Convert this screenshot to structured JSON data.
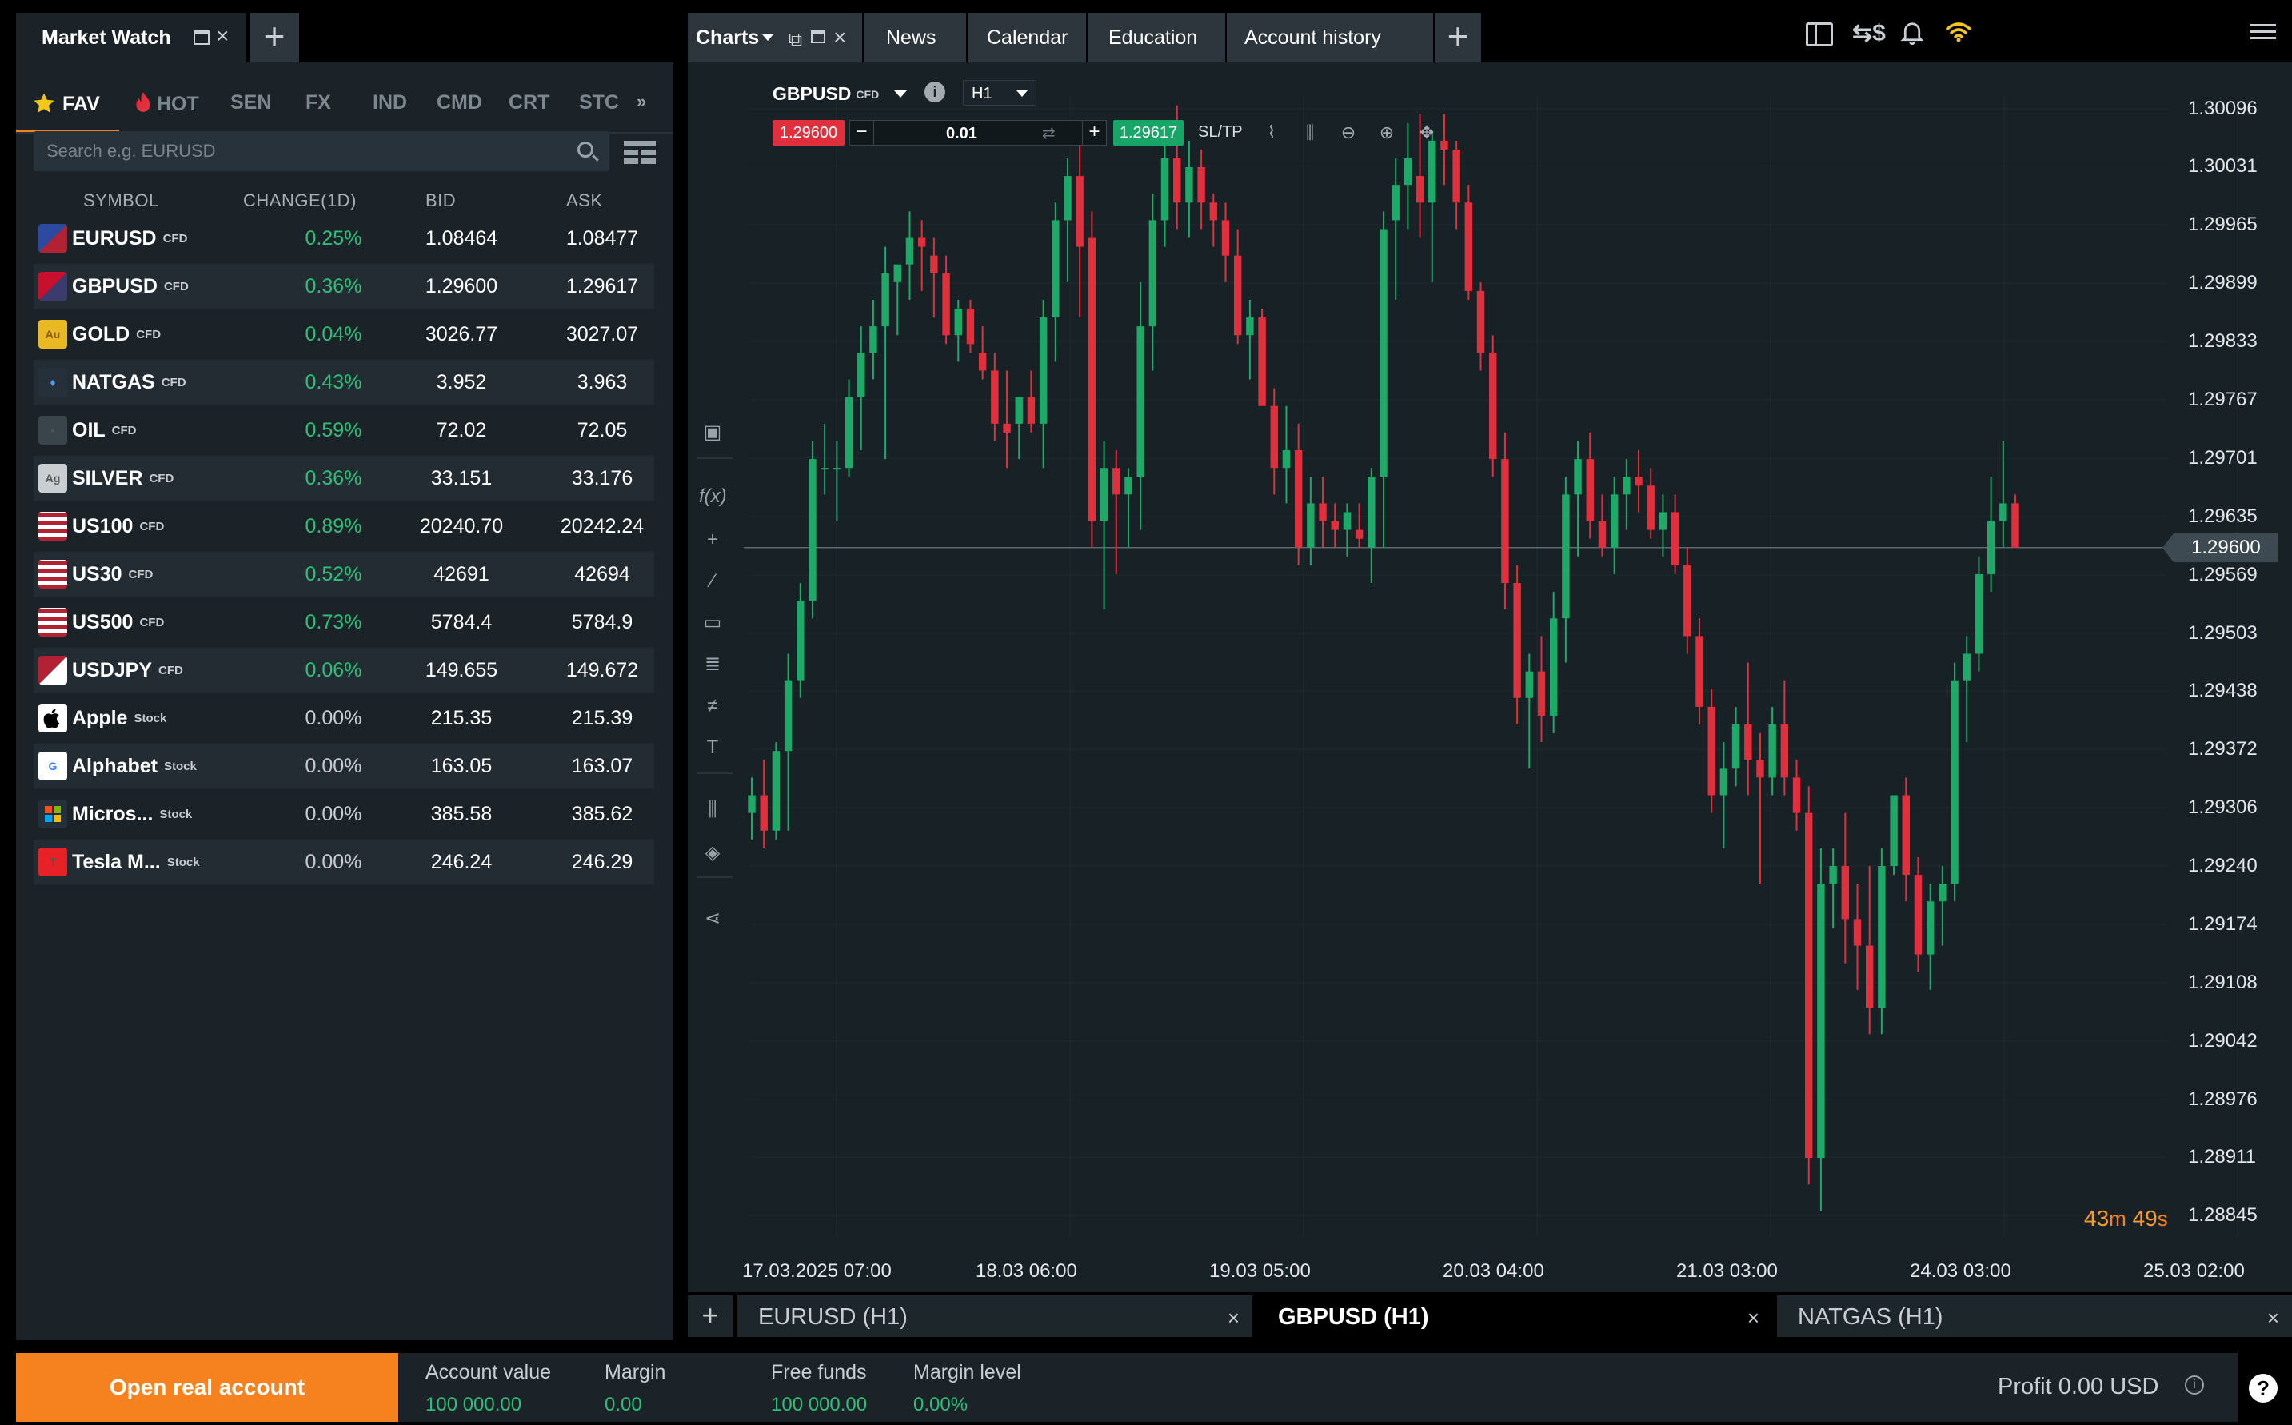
{
  "market_watch": {
    "title": "Market Watch",
    "categories": [
      {
        "label": "FAV",
        "icon": "star-icon",
        "active": true
      },
      {
        "label": "HOT",
        "icon": "flame-icon",
        "active": false
      },
      {
        "label": "SEN",
        "active": false
      },
      {
        "label": "FX",
        "active": false
      },
      {
        "label": "IND",
        "active": false
      },
      {
        "label": "CMD",
        "active": false
      },
      {
        "label": "CRT",
        "active": false
      },
      {
        "label": "STC",
        "active": false
      }
    ],
    "search_placeholder": "Search e.g. EURUSD",
    "columns": {
      "symbol": "SYMBOL",
      "change": "CHANGE(1D)",
      "bid": "BID",
      "ask": "ASK"
    },
    "rows": [
      {
        "symbol": "EURUSD",
        "type": "CFD",
        "change": "0.25%",
        "bid": "1.08464",
        "ask": "1.08477",
        "flag": "eu-us-flag-icon"
      },
      {
        "symbol": "GBPUSD",
        "type": "CFD",
        "change": "0.36%",
        "bid": "1.29600",
        "ask": "1.29617",
        "flag": "gb-us-flag-icon"
      },
      {
        "symbol": "GOLD",
        "type": "CFD",
        "change": "0.04%",
        "bid": "3026.77",
        "ask": "3027.07",
        "flag": "gold-icon"
      },
      {
        "symbol": "NATGAS",
        "type": "CFD",
        "change": "0.43%",
        "bid": "3.952",
        "ask": "3.963",
        "flag": "gas-flame-icon"
      },
      {
        "symbol": "OIL",
        "type": "CFD",
        "change": "0.59%",
        "bid": "72.02",
        "ask": "72.05",
        "flag": "oil-barrel-icon"
      },
      {
        "symbol": "SILVER",
        "type": "CFD",
        "change": "0.36%",
        "bid": "33.151",
        "ask": "33.176",
        "flag": "silver-icon"
      },
      {
        "symbol": "US100",
        "type": "CFD",
        "change": "0.89%",
        "bid": "20240.70",
        "ask": "20242.24",
        "flag": "us-flag-icon"
      },
      {
        "symbol": "US30",
        "type": "CFD",
        "change": "0.52%",
        "bid": "42691",
        "ask": "42694",
        "flag": "us-flag-icon"
      },
      {
        "symbol": "US500",
        "type": "CFD",
        "change": "0.73%",
        "bid": "5784.4",
        "ask": "5784.9",
        "flag": "us-flag-icon"
      },
      {
        "symbol": "USDJPY",
        "type": "CFD",
        "change": "0.06%",
        "bid": "149.655",
        "ask": "149.672",
        "flag": "us-jp-flag-icon"
      },
      {
        "symbol": "Apple",
        "type": "Stock",
        "change": "0.00%",
        "bid": "215.35",
        "ask": "215.39",
        "flag": "apple-logo-icon"
      },
      {
        "symbol": "Alphabet",
        "type": "Stock",
        "change": "0.00%",
        "bid": "163.05",
        "ask": "163.07",
        "flag": "google-logo-icon"
      },
      {
        "symbol": "Micros...",
        "type": "Stock",
        "change": "0.00%",
        "bid": "385.58",
        "ask": "385.62",
        "flag": "microsoft-logo-icon"
      },
      {
        "symbol": "Tesla M...",
        "type": "Stock",
        "change": "0.00%",
        "bid": "246.24",
        "ask": "246.29",
        "flag": "tesla-logo-icon"
      }
    ]
  },
  "top_tabs": {
    "charts": "Charts",
    "news": "News",
    "calendar": "Calendar",
    "education": "Education",
    "account_history": "Account history"
  },
  "chart": {
    "symbol": "GBPUSD",
    "symbol_type": "CFD",
    "timeframe": "H1",
    "sell_price": "1.29600",
    "buy_price": "1.29617",
    "volume": "0.01",
    "sltp_label": "SL/TP",
    "current_price_tag": "1.29600",
    "countdown": {
      "min": "43",
      "min_unit": "m",
      "sec": "49",
      "sec_unit": "s"
    }
  },
  "chart_data": {
    "type": "candlestick",
    "x_tick_labels": [
      "17.03.2025 07:00",
      "18.03 06:00",
      "19.03 05:00",
      "20.03 04:00",
      "21.03 03:00",
      "24.03 03:00",
      "25.03 02:00"
    ],
    "y_tick_labels": [
      "1.30096",
      "1.30031",
      "1.29965",
      "1.29899",
      "1.29833",
      "1.29767",
      "1.29701",
      "1.29635",
      "1.29569",
      "1.29503",
      "1.29438",
      "1.29372",
      "1.29306",
      "1.29240",
      "1.29174",
      "1.29108",
      "1.29042",
      "1.28976",
      "1.28911",
      "1.28845"
    ],
    "ylim": [
      1.28845,
      1.30096
    ],
    "current_price": 1.296,
    "candles": [
      [
        1.293,
        1.2934,
        1.2927,
        1.2932
      ],
      [
        1.2932,
        1.2936,
        1.2926,
        1.2928
      ],
      [
        1.2928,
        1.2938,
        1.2927,
        1.2937
      ],
      [
        1.2937,
        1.2948,
        1.2928,
        1.2945
      ],
      [
        1.2945,
        1.2956,
        1.2943,
        1.2954
      ],
      [
        1.2954,
        1.2972,
        1.2952,
        1.297
      ],
      [
        1.2969,
        1.2974,
        1.2966,
        1.2969
      ],
      [
        1.2969,
        1.2972,
        1.2963,
        1.2969
      ],
      [
        1.2969,
        1.2979,
        1.2968,
        1.2977
      ],
      [
        1.2977,
        1.2985,
        1.2971,
        1.2982
      ],
      [
        1.2982,
        1.2988,
        1.2979,
        1.2985
      ],
      [
        1.2985,
        1.2994,
        1.297,
        1.2991
      ],
      [
        1.299,
        1.2992,
        1.2984,
        1.2992
      ],
      [
        1.2992,
        1.2998,
        1.2988,
        1.2995
      ],
      [
        1.2995,
        1.2997,
        1.2989,
        1.2994
      ],
      [
        1.2993,
        1.2995,
        1.2986,
        1.2991
      ],
      [
        1.2991,
        1.2993,
        1.2983,
        1.2984
      ],
      [
        1.2984,
        1.2988,
        1.2981,
        1.2987
      ],
      [
        1.2987,
        1.2988,
        1.2982,
        1.2983
      ],
      [
        1.2982,
        1.2985,
        1.2979,
        1.298
      ],
      [
        1.298,
        1.2982,
        1.2972,
        1.2974
      ],
      [
        1.2974,
        1.298,
        1.2969,
        1.2973
      ],
      [
        1.2974,
        1.2977,
        1.297,
        1.2977
      ],
      [
        1.2977,
        1.298,
        1.2973,
        1.2974
      ],
      [
        1.2974,
        1.2988,
        1.2969,
        1.2986
      ],
      [
        1.2986,
        1.2999,
        1.2981,
        1.2997
      ],
      [
        1.2997,
        1.3004,
        1.299,
        1.3002
      ],
      [
        1.3002,
        1.3008,
        1.2986,
        1.2994
      ],
      [
        1.2995,
        1.2998,
        1.296,
        1.2963
      ],
      [
        1.2963,
        1.2972,
        1.2953,
        1.2969
      ],
      [
        1.2969,
        1.2971,
        1.2957,
        1.2966
      ],
      [
        1.2966,
        1.2969,
        1.296,
        1.2968
      ],
      [
        1.2968,
        1.299,
        1.2962,
        1.2985
      ],
      [
        1.2985,
        1.3,
        1.298,
        1.2997
      ],
      [
        1.2997,
        1.3008,
        1.2994,
        1.3004
      ],
      [
        1.3004,
        1.301,
        1.2996,
        1.2999
      ],
      [
        1.2999,
        1.3006,
        1.2995,
        1.3003
      ],
      [
        1.3003,
        1.3005,
        1.2996,
        1.2999
      ],
      [
        1.2999,
        1.3,
        1.2994,
        1.2997
      ],
      [
        1.2997,
        1.2999,
        1.299,
        1.2993
      ],
      [
        1.2993,
        1.2996,
        1.2983,
        1.2984
      ],
      [
        1.2984,
        1.2988,
        1.2979,
        1.2986
      ],
      [
        1.2986,
        1.2987,
        1.2977,
        1.2976
      ],
      [
        1.2976,
        1.2978,
        1.2966,
        1.2969
      ],
      [
        1.2969,
        1.2976,
        1.2965,
        1.2971
      ],
      [
        1.2971,
        1.2974,
        1.2958,
        1.296
      ],
      [
        1.296,
        1.2968,
        1.2958,
        1.2965
      ],
      [
        1.2965,
        1.2968,
        1.296,
        1.2963
      ],
      [
        1.2963,
        1.2965,
        1.296,
        1.2962
      ],
      [
        1.2962,
        1.2965,
        1.2959,
        1.2964
      ],
      [
        1.2962,
        1.2965,
        1.296,
        1.2961
      ],
      [
        1.296,
        1.2969,
        1.2956,
        1.2968
      ],
      [
        1.2968,
        1.2998,
        1.296,
        1.2996
      ],
      [
        1.2997,
        1.3004,
        1.2988,
        1.3001
      ],
      [
        1.3001,
        1.3008,
        1.2996,
        1.3004
      ],
      [
        1.3002,
        1.3009,
        1.2995,
        1.2999
      ],
      [
        1.2999,
        1.3007,
        1.299,
        1.3006
      ],
      [
        1.3006,
        1.3009,
        1.3001,
        1.3005
      ],
      [
        1.3005,
        1.3006,
        1.2996,
        1.2999
      ],
      [
        1.2999,
        1.3001,
        1.2988,
        1.2989
      ],
      [
        1.2989,
        1.299,
        1.298,
        1.2982
      ],
      [
        1.2982,
        1.2984,
        1.2968,
        1.297
      ],
      [
        1.297,
        1.2973,
        1.2953,
        1.2956
      ],
      [
        1.2956,
        1.2958,
        1.294,
        1.2943
      ],
      [
        1.2943,
        1.2948,
        1.2935,
        1.2946
      ],
      [
        1.2946,
        1.295,
        1.2938,
        1.2941
      ],
      [
        1.2941,
        1.2955,
        1.2939,
        1.2952
      ],
      [
        1.2952,
        1.2968,
        1.2947,
        1.2966
      ],
      [
        1.2966,
        1.2972,
        1.2959,
        1.297
      ],
      [
        1.297,
        1.2973,
        1.2961,
        1.2963
      ],
      [
        1.2963,
        1.2966,
        1.2959,
        1.296
      ],
      [
        1.296,
        1.2968,
        1.2957,
        1.2966
      ],
      [
        1.2966,
        1.297,
        1.2962,
        1.2968
      ],
      [
        1.2968,
        1.2971,
        1.2964,
        1.2967
      ],
      [
        1.2967,
        1.2969,
        1.2961,
        1.2962
      ],
      [
        1.2962,
        1.2966,
        1.2959,
        1.2964
      ],
      [
        1.2964,
        1.2966,
        1.2957,
        1.2958
      ],
      [
        1.2958,
        1.296,
        1.2948,
        1.295
      ],
      [
        1.295,
        1.2952,
        1.294,
        1.2942
      ],
      [
        1.2942,
        1.2944,
        1.293,
        1.2932
      ],
      [
        1.2932,
        1.2938,
        1.2926,
        1.2935
      ],
      [
        1.2935,
        1.2942,
        1.2933,
        1.294
      ],
      [
        1.294,
        1.2947,
        1.2932,
        1.2936
      ],
      [
        1.2936,
        1.2939,
        1.2922,
        1.2934
      ],
      [
        1.2934,
        1.2942,
        1.2932,
        1.294
      ],
      [
        1.294,
        1.2945,
        1.2932,
        1.2934
      ],
      [
        1.2934,
        1.2936,
        1.2928,
        1.293
      ],
      [
        1.293,
        1.2933,
        1.2888,
        1.2891
      ],
      [
        1.2891,
        1.2926,
        1.2885,
        1.2922
      ],
      [
        1.2922,
        1.2926,
        1.2917,
        1.2924
      ],
      [
        1.2924,
        1.293,
        1.2913,
        1.2918
      ],
      [
        1.2918,
        1.2922,
        1.291,
        1.2915
      ],
      [
        1.2915,
        1.2924,
        1.2905,
        1.2908
      ],
      [
        1.2908,
        1.2926,
        1.2905,
        1.2924
      ],
      [
        1.2924,
        1.2931,
        1.2923,
        1.2932
      ],
      [
        1.2932,
        1.2934,
        1.292,
        1.2923
      ],
      [
        1.2923,
        1.2925,
        1.2912,
        1.2914
      ],
      [
        1.2914,
        1.2922,
        1.291,
        1.292
      ],
      [
        1.292,
        1.2924,
        1.2915,
        1.2922
      ],
      [
        1.2922,
        1.2947,
        1.292,
        1.2945
      ],
      [
        1.2945,
        1.295,
        1.2938,
        1.2948
      ],
      [
        1.2948,
        1.2959,
        1.2946,
        1.2957
      ],
      [
        1.2957,
        1.2968,
        1.2955,
        1.2963
      ],
      [
        1.2963,
        1.2972,
        1.296,
        1.2965
      ],
      [
        1.2965,
        1.2966,
        1.296,
        1.296
      ]
    ]
  },
  "chart_tabs": [
    {
      "label": "EURUSD (H1)",
      "active": false
    },
    {
      "label": "GBPUSD (H1)",
      "active": true
    },
    {
      "label": "NATGAS (H1)",
      "active": false
    }
  ],
  "footer": {
    "open_real": "Open real account",
    "stats": [
      {
        "label": "Account value",
        "value": "100 000.00"
      },
      {
        "label": "Margin",
        "value": "0.00"
      },
      {
        "label": "Free funds",
        "value": "100 000.00"
      },
      {
        "label": "Margin level",
        "value": "0.00%"
      }
    ],
    "profit": "Profit 0.00 USD"
  },
  "colors": {
    "accent": "#f5821f",
    "positive": "#2ebf78",
    "bull_candle": "#1fa968",
    "bear_candle": "#e0303e",
    "panel_bg": "#1b2328",
    "chart_bg": "#172126"
  }
}
